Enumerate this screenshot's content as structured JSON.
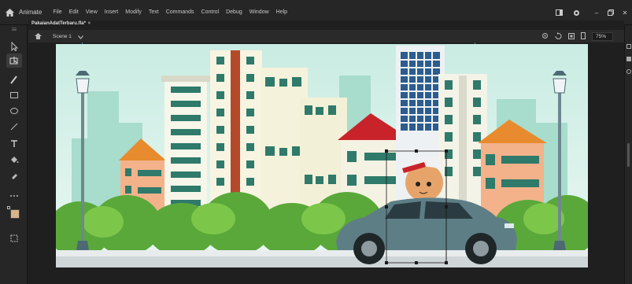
{
  "app": {
    "name": "Animate"
  },
  "menu": {
    "items": [
      "File",
      "Edit",
      "View",
      "Insert",
      "Modify",
      "Text",
      "Commands",
      "Control",
      "Debug",
      "Window",
      "Help"
    ]
  },
  "document": {
    "tab_title": "PakaianAdatTerbaru.fla*",
    "tab_close": "×",
    "scene_label": "Scene 1",
    "zoom": "75%"
  },
  "tools": [
    {
      "name": "selection-tool-icon"
    },
    {
      "name": "subselection-tool-icon"
    },
    {
      "name": "free-transform-tool-icon"
    },
    {
      "name": "brush-tool-icon"
    },
    {
      "name": "rectangle-tool-icon"
    },
    {
      "name": "oval-tool-icon"
    },
    {
      "name": "line-tool-icon"
    },
    {
      "name": "text-tool-icon"
    },
    {
      "name": "paint-bucket-tool-icon"
    },
    {
      "name": "eyedropper-tool-icon"
    },
    {
      "name": "more-tools-icon"
    }
  ],
  "colors": {
    "stroke_swatch": "#2a2a2a",
    "fill_swatch": "#d8b48a",
    "sky_top": "#cfeee6",
    "sky_bottom": "#e8f7f2",
    "bush": "#5aa83a",
    "car": "#5e7e86",
    "roof_red": "#c8232a",
    "roof_orange": "#e88a2e",
    "selection": "#1a1a1a"
  }
}
